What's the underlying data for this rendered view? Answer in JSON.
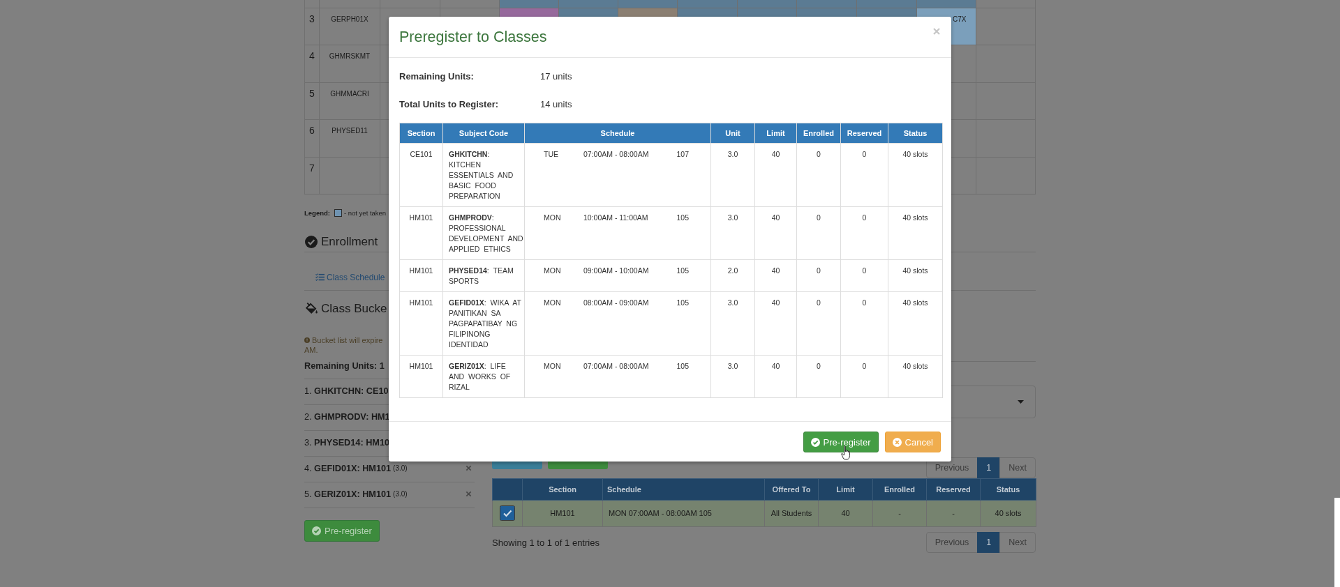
{
  "schedule_grid": {
    "rows": [
      {
        "cells": [
          {
            "filled": false
          },
          {
            "filled": false
          },
          {
            "filled": true,
            "color": "#5b7b93"
          },
          {
            "filled": true,
            "color": "#5b7b93"
          },
          {
            "filled": true,
            "color": "#5b7b93"
          },
          {
            "filled": true,
            "color": "#5b7b93"
          },
          {
            "filled": true,
            "color": "#5b7b93"
          },
          {
            "filled": true,
            "color": "#5b7b93"
          },
          {
            "filled": true,
            "color": "#5b7b93"
          },
          {
            "filled": true,
            "color": "#5b7b93"
          },
          {
            "filled": false
          }
        ]
      },
      {
        "number": "3",
        "code": "GERPH01X",
        "cells": [
          {
            "filled": false
          },
          {
            "filled": false
          },
          {
            "filled": true,
            "color": "#96699c"
          },
          {
            "filled": true,
            "color": "#5b7b93"
          },
          {
            "filled": true,
            "color": "#8b7f72"
          },
          {
            "filled": true,
            "color": "#5b7b93"
          },
          {
            "filled": true,
            "color": "#5b7b93"
          },
          {
            "filled": true,
            "color": "#5b7b93"
          },
          {
            "filled": true,
            "color": "#5b7b93"
          },
          {
            "filled": true,
            "color": "#7b9fbb",
            "text": "C7X"
          },
          {
            "filled": false
          }
        ]
      },
      {
        "number": "4",
        "code": "GHMRSKMT"
      },
      {
        "number": "5",
        "code": "GHMMACRI"
      },
      {
        "number": "6",
        "code": "PHYSED11"
      },
      {
        "number": "7"
      }
    ]
  },
  "legend": {
    "label": "Legend:",
    "items": [
      {
        "color": "#6f93b1",
        "text": "- not yet taken"
      }
    ]
  },
  "enrollment_heading": "Enrollment",
  "tabs": [
    {
      "label": "Class Schedule",
      "selected": false
    }
  ],
  "bucket": {
    "heading": "Class Bucke",
    "notice": [
      "Bucket list will expire",
      "AM."
    ],
    "remaining": "Remaining Units: 1",
    "items": [
      {
        "text": "1. **GHKITCHN: CE10**"
      },
      {
        "text": "2. **GHMPRODV: HM1**"
      },
      {
        "text": "3. **PHYSED14: HM10**"
      },
      {
        "text": "4. **GEFID01X: HM101**",
        "units": "(3.0)"
      },
      {
        "text": "5. **GERIZ01X: HM101**",
        "units": "(3.0)"
      }
    ],
    "button": "Pre-register"
  },
  "pagination_top": [
    {
      "label": "Previous",
      "selected": false,
      "disabled": true
    },
    {
      "label": "1",
      "selected": true,
      "disabled": false
    },
    {
      "label": "Next",
      "selected": false,
      "disabled": true
    }
  ],
  "offerings_table": {
    "columns": [
      "Section",
      "Schedule",
      "Offered To",
      "Limit",
      "Enrolled",
      "Reserved",
      "Status"
    ],
    "rows": [
      {
        "selected": true,
        "checked": true,
        "cells": [
          "HM101",
          "MON 07:00AM - 08:00AM 105",
          "All Students",
          "40",
          "-",
          "-",
          "40 slots"
        ]
      }
    ]
  },
  "entries_info": "Showing 1 to 1 of 1 entries",
  "pagination_bottom": [
    {
      "label": "Previous",
      "selected": false,
      "disabled": true
    },
    {
      "label": "1",
      "selected": true,
      "disabled": false
    },
    {
      "label": "Next",
      "selected": false,
      "disabled": true
    }
  ],
  "modal": {
    "title": "Preregister to Classes",
    "summary": [
      {
        "label": "Remaining Units:",
        "value": "17 units"
      },
      {
        "label": "Total Units to Register:",
        "value": "14 units"
      }
    ],
    "table": {
      "columns": [
        "Section",
        "Subject Code",
        "Schedule",
        "Unit",
        "Limit",
        "Enrolled",
        "Reserved",
        "Status"
      ],
      "rows": [
        {
          "section": "CE101",
          "subject": "**GHKITCHN**: KITCHEN ESSENTIALS AND BASIC FOOD PREPARATION",
          "day": "TUE",
          "time": "07:00AM - 08:00AM",
          "room": "107",
          "unit": "3.0",
          "limit": "40",
          "enrolled": "0",
          "reserved": "0",
          "status": "40 slots"
        },
        {
          "section": "HM101",
          "subject": "**GHMPRODV**: PROFESSIONAL DEVELOPMENT AND APPLIED ETHICS",
          "day": "MON",
          "time": "10:00AM - 11:00AM",
          "room": "105",
          "unit": "3.0",
          "limit": "40",
          "enrolled": "0",
          "reserved": "0",
          "status": "40 slots"
        },
        {
          "section": "HM101",
          "subject": "**PHYSED14**: TEAM SPORTS",
          "day": "MON",
          "time": "09:00AM - 10:00AM",
          "room": "105",
          "unit": "2.0",
          "limit": "40",
          "enrolled": "0",
          "reserved": "0",
          "status": "40 slots"
        },
        {
          "section": "HM101",
          "subject": "**GEFID01X**: WIKA AT PANITIKAN SA PAGPAPATIBAY NG FILIPINONG IDENTIDAD",
          "day": "MON",
          "time": "08:00AM - 09:00AM",
          "room": "105",
          "unit": "3.0",
          "limit": "40",
          "enrolled": "0",
          "reserved": "0",
          "status": "40 slots"
        },
        {
          "section": "HM101",
          "subject": "**GERIZ01X**: LIFE AND WORKS OF RIZAL",
          "day": "MON",
          "time": "07:00AM - 08:00AM",
          "room": "105",
          "unit": "3.0",
          "limit": "40",
          "enrolled": "0",
          "reserved": "0",
          "status": "40 slots"
        }
      ]
    },
    "buttons": [
      {
        "label": "Pre-register",
        "kind": "primary"
      },
      {
        "label": "Cancel",
        "kind": "cancel"
      }
    ]
  }
}
